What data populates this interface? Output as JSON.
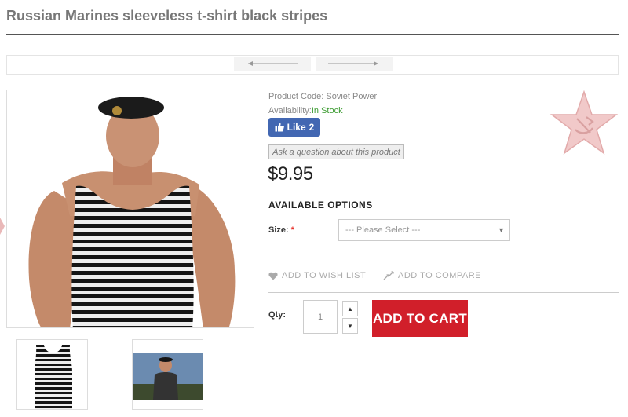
{
  "product": {
    "title": "Russian Marines sleeveless t-shirt black stripes",
    "code_label": "Product Code:",
    "code_value": "Soviet Power",
    "availability_label": "Availability:",
    "availability_value": "In Stock",
    "price": "$9.95"
  },
  "social": {
    "like_label": "Like",
    "like_count": "2"
  },
  "ask": {
    "label": "Ask a question about this product"
  },
  "options": {
    "heading": "AVAILABLE OPTIONS",
    "size_label": "Size:",
    "required_mark": "*",
    "size_placeholder": "--- Please Select ---"
  },
  "actions": {
    "wishlist_label": "ADD TO WISH LIST",
    "compare_label": "ADD TO COMPARE",
    "qty_label": "Qty:",
    "qty_value": "1",
    "add_to_cart_label": "ADD TO CART"
  },
  "colors": {
    "accent_red": "#d11f2a",
    "in_stock_green": "#3b9b30",
    "facebook_blue": "#4267b2"
  },
  "icons": {
    "pager_prev": "arrow-left-icon",
    "pager_next": "arrow-right-icon",
    "like": "thumbs-up-icon",
    "wishlist": "heart-icon",
    "compare": "compare-arrows-icon",
    "qty_up": "caret-up-icon",
    "qty_down": "caret-down-icon",
    "select": "caret-down-icon",
    "badge": "soviet-star-icon"
  }
}
